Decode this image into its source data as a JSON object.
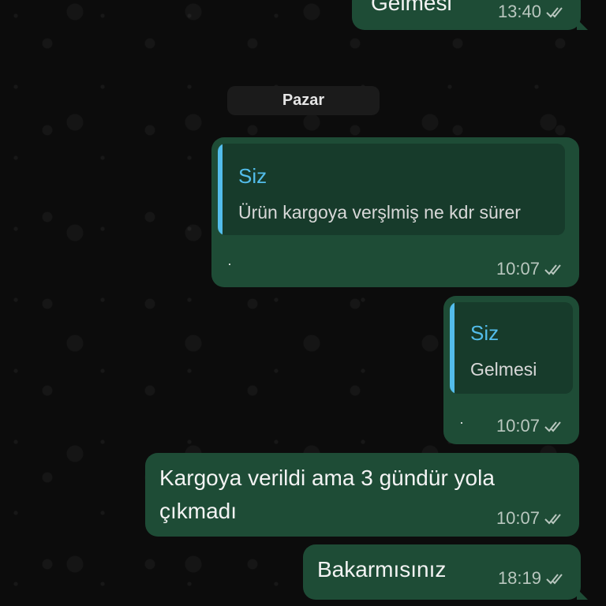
{
  "chat": {
    "day_separator": "Pazar",
    "messages": [
      {
        "type": "text",
        "text": "Gelmesi",
        "time": "13:40",
        "status": "read"
      },
      {
        "type": "reply",
        "quoted_author": "Siz",
        "quoted_text": "Ürün kargoya verşlmiş ne kdr sürer",
        "text": "·",
        "time": "10:07",
        "status": "read"
      },
      {
        "type": "reply",
        "quoted_author": "Siz",
        "quoted_text": "Gelmesi",
        "text": "·",
        "time": "10:07",
        "status": "read"
      },
      {
        "type": "text",
        "text_line1": "Kargoya verildi ama 3 gündür yola",
        "text_line2": "çıkmadı",
        "time": "10:07",
        "status": "read"
      },
      {
        "type": "text",
        "text": "Bakarmısınız",
        "time": "18:19",
        "status": "read"
      }
    ]
  },
  "colors": {
    "outgoing_bubble": "#1e4c36",
    "quote_bar": "#53bdeb",
    "read_ticks": "#b9c7bf"
  },
  "icons": {
    "status": "double-check-icon"
  }
}
